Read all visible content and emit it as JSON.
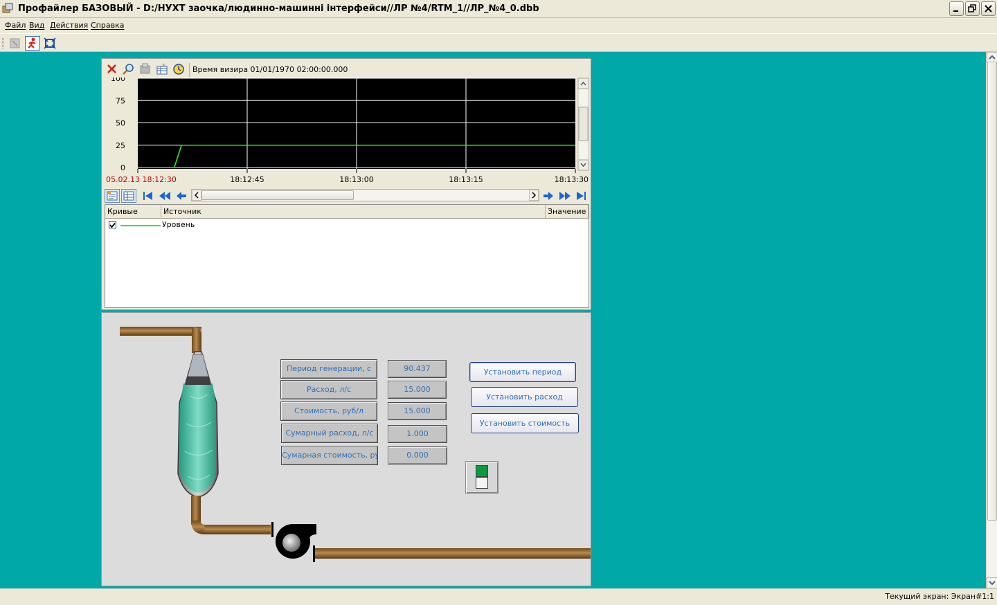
{
  "window": {
    "title": "Профайлер БАЗОВЫЙ - D:/НУХТ заочка/людинно-машинні інтерфейси//ЛР №4/RTM_1//ЛР_№4_0.dbb"
  },
  "menu": [
    {
      "label": "Файл"
    },
    {
      "label": "Вид"
    },
    {
      "label": "Действия"
    },
    {
      "label": "Справка"
    }
  ],
  "trend": {
    "vizir_text": "Время визира 01/01/1970 02:00:00.000",
    "y_ticks": [
      "100",
      "75",
      "50",
      "25",
      "0"
    ],
    "x_ticks": [
      "05.02.13 18:12:30",
      "18:12:45",
      "18:13:00",
      "18:13:15",
      "18:13:30"
    ],
    "first_tick_color": "#c00000",
    "background_color": "#000000",
    "line_color": "#32e832",
    "columns": [
      "Кривые",
      "Источник",
      "Значение"
    ],
    "curves": [
      {
        "name": "Уровень",
        "checked": true,
        "color": "#32e832"
      }
    ]
  },
  "chart_data": {
    "type": "line",
    "xlabel": "",
    "ylabel": "",
    "ylim": [
      0,
      100
    ],
    "x_categories": [
      "18:12:30",
      "18:12:45",
      "18:13:00",
      "18:13:15",
      "18:13:30"
    ],
    "grid": true,
    "series": [
      {
        "name": "Уровень",
        "x_seconds_from_start": [
          0,
          5,
          6,
          60
        ],
        "values": [
          0,
          0,
          25,
          25
        ]
      }
    ]
  },
  "mimic": {
    "labels": [
      {
        "label": "Период генерации, с",
        "value": "90.437"
      },
      {
        "label": "Расход, л/с",
        "value": "15.000"
      },
      {
        "label": "Стоимость, руб/л",
        "value": "15.000"
      },
      {
        "label": "Сумарный расход, л/с",
        "value": "1.000"
      },
      {
        "label": "Сумарная стоимость, руб",
        "value": "0.000"
      }
    ],
    "buttons": {
      "set_period": "Установить период",
      "set_rate": "Установить расход",
      "set_cost": "Установить стоимость"
    },
    "toggle_state": "on",
    "pipe_color": "#9c6b2e",
    "liquid_color": "#3fbba0"
  },
  "status": {
    "text": "Текущий экран: Экран#1:1"
  }
}
